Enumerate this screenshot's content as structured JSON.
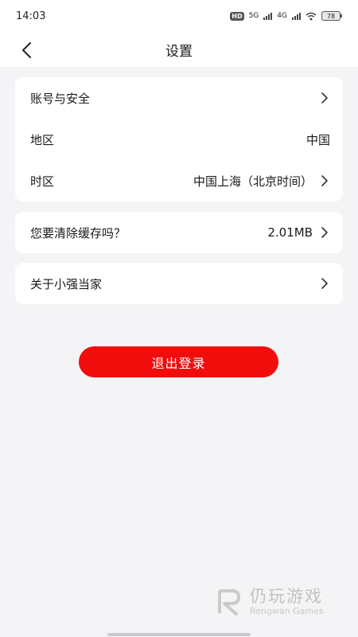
{
  "status_bar": {
    "time": "14:03",
    "hd": "HD",
    "net1": "5G",
    "net2": "4G",
    "battery": "78"
  },
  "header": {
    "title": "设置",
    "back_icon": "chevron-left-icon"
  },
  "settings_group_1": {
    "items": [
      {
        "label": "账号与安全",
        "value": "",
        "has_arrow": true
      },
      {
        "label": "地区",
        "value": "中国",
        "has_arrow": false
      },
      {
        "label": "时区",
        "value": "中国上海（北京时间）",
        "has_arrow": true
      }
    ]
  },
  "settings_group_2": {
    "items": [
      {
        "label": "您要清除缓存吗？",
        "value": "2.01MB",
        "has_arrow": true
      }
    ]
  },
  "settings_group_3": {
    "items": [
      {
        "label": "关于小强当家",
        "value": "",
        "has_arrow": true
      }
    ]
  },
  "logout": {
    "label": "退出登录",
    "color": "#f20d0d"
  },
  "watermark": {
    "title": "仍玩游戏",
    "subtitle": "Rengwan Games"
  }
}
